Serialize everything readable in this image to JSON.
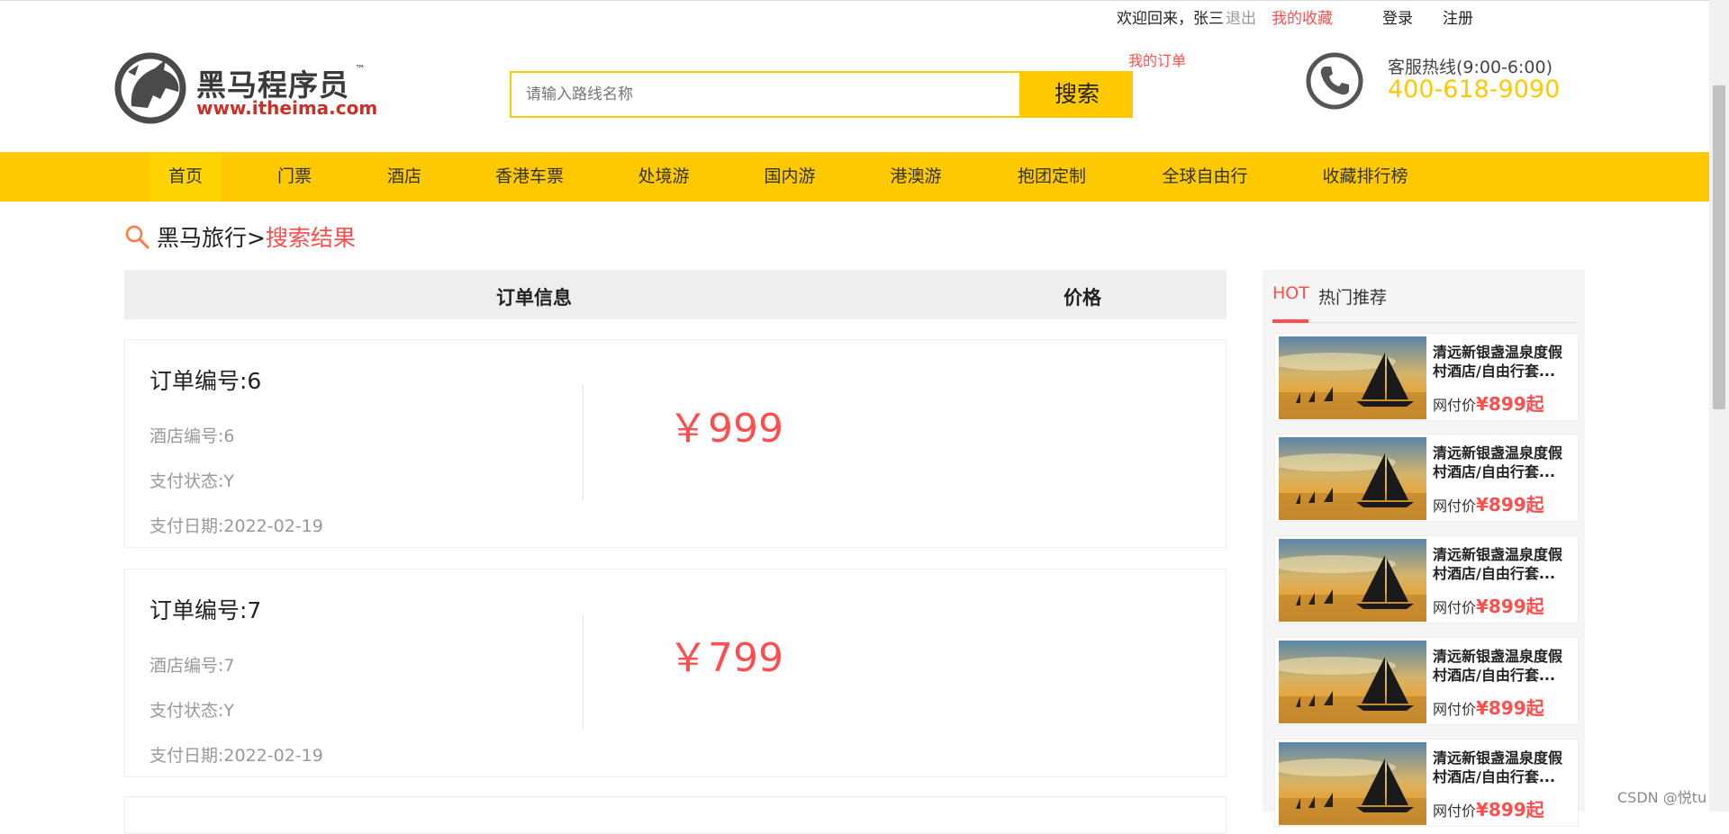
{
  "topbar": {
    "welcome": "欢迎回来，张三",
    "logout": "退出",
    "favorites": "我的收藏",
    "login": "登录",
    "register": "注册",
    "my_orders": "我的订单"
  },
  "logo": {
    "name": "黑马程序员",
    "tm": "™",
    "url": "www.itheima.com"
  },
  "search": {
    "placeholder": "请输入路线名称",
    "button": "搜索"
  },
  "hotline": {
    "label": "客服热线(9:00-6:00)",
    "number": "400-618-9090"
  },
  "nav": [
    "首页",
    "门票",
    "酒店",
    "香港车票",
    "处境游",
    "国内游",
    "港澳游",
    "抱团定制",
    "全球自由行",
    "收藏排行榜"
  ],
  "breadcrumb": {
    "home": "黑马旅行",
    "sep": ">",
    "current": "搜索结果"
  },
  "table_header": {
    "info": "订单信息",
    "price": "价格"
  },
  "orders": [
    {
      "title": "订单编号:6",
      "hotel": "酒店编号:6",
      "status": "支付状态:Y",
      "date": "支付日期:2022-02-19",
      "price": "￥999"
    },
    {
      "title": "订单编号:7",
      "hotel": "酒店编号:7",
      "status": "支付状态:Y",
      "date": "支付日期:2022-02-19",
      "price": "￥799"
    }
  ],
  "sidebar": {
    "hot": "HOT",
    "title": "热门推荐",
    "items": [
      {
        "name": "清远新银盏温泉度假村酒店/自由行套...",
        "price_label": "网付价",
        "price": "¥899起"
      },
      {
        "name": "清远新银盏温泉度假村酒店/自由行套...",
        "price_label": "网付价",
        "price": "¥899起"
      },
      {
        "name": "清远新银盏温泉度假村酒店/自由行套...",
        "price_label": "网付价",
        "price": "¥899起"
      },
      {
        "name": "清远新银盏温泉度假村酒店/自由行套...",
        "price_label": "网付价",
        "price": "¥899起"
      },
      {
        "name": "清远新银盏温泉度假村酒店/自由行套...",
        "price_label": "网付价",
        "price": "¥899起"
      }
    ]
  },
  "watermark": "CSDN @悦tu",
  "colors": {
    "brand_yellow": "#ffc900",
    "accent_red": "#ff4e4e"
  }
}
